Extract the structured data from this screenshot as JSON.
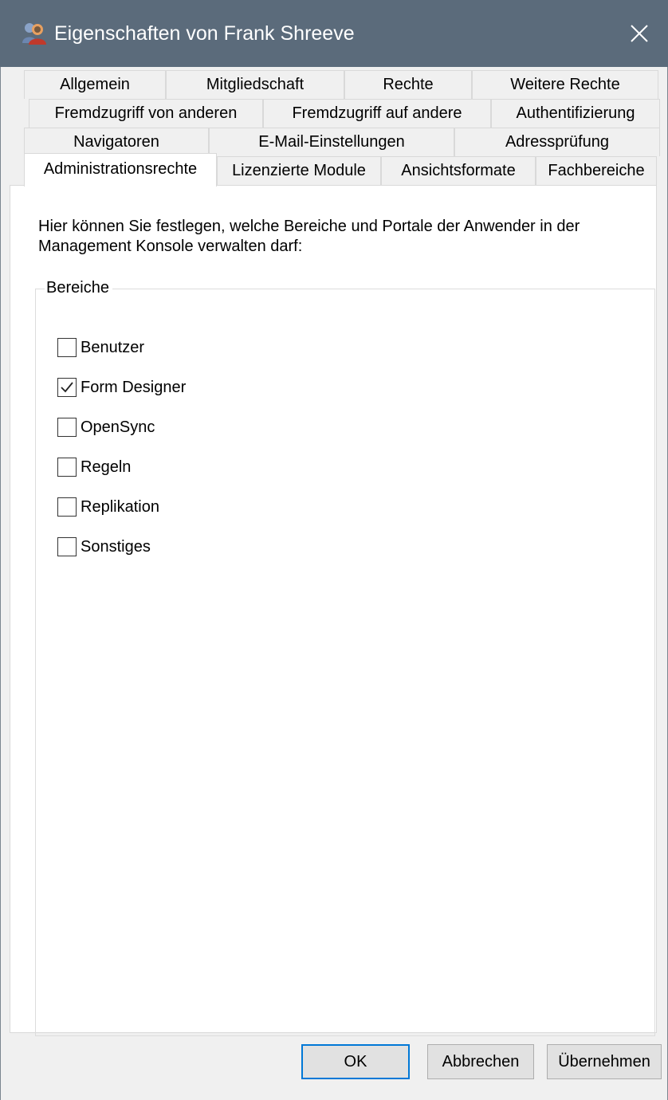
{
  "window": {
    "title": "Eigenschaften von Frank Shreeve",
    "icon": "user-properties-icon",
    "close_icon": "close-icon"
  },
  "tabs": {
    "row1": [
      {
        "label": "Allgemein"
      },
      {
        "label": "Mitgliedschaft"
      },
      {
        "label": "Rechte"
      },
      {
        "label": "Weitere Rechte"
      }
    ],
    "row2": [
      {
        "label": "Fremdzugriff von anderen"
      },
      {
        "label": "Fremdzugriff auf andere"
      },
      {
        "label": "Authentifizierung"
      }
    ],
    "row3": [
      {
        "label": "Navigatoren"
      },
      {
        "label": "E-Mail-Einstellungen"
      },
      {
        "label": "Adressprüfung"
      }
    ],
    "row4": [
      {
        "label": "Administrationsrechte",
        "active": true
      },
      {
        "label": "Lizenzierte Module"
      },
      {
        "label": "Ansichtsformate"
      },
      {
        "label": "Fachbereiche"
      }
    ]
  },
  "content": {
    "description": "Hier können Sie festlegen, welche Bereiche und Portale der Anwender in der Management Konsole verwalten darf:",
    "group_label": "Bereiche",
    "checkboxes": [
      {
        "label": "Benutzer",
        "checked": false
      },
      {
        "label": "Form Designer",
        "checked": true
      },
      {
        "label": "OpenSync",
        "checked": false
      },
      {
        "label": "Regeln",
        "checked": false
      },
      {
        "label": "Replikation",
        "checked": false
      },
      {
        "label": "Sonstiges",
        "checked": false
      }
    ]
  },
  "buttons": {
    "ok": "OK",
    "cancel": "Abbrechen",
    "apply": "Übernehmen"
  },
  "colors": {
    "titlebar": "#5b6b7b",
    "default_button_border": "#0078d7"
  }
}
